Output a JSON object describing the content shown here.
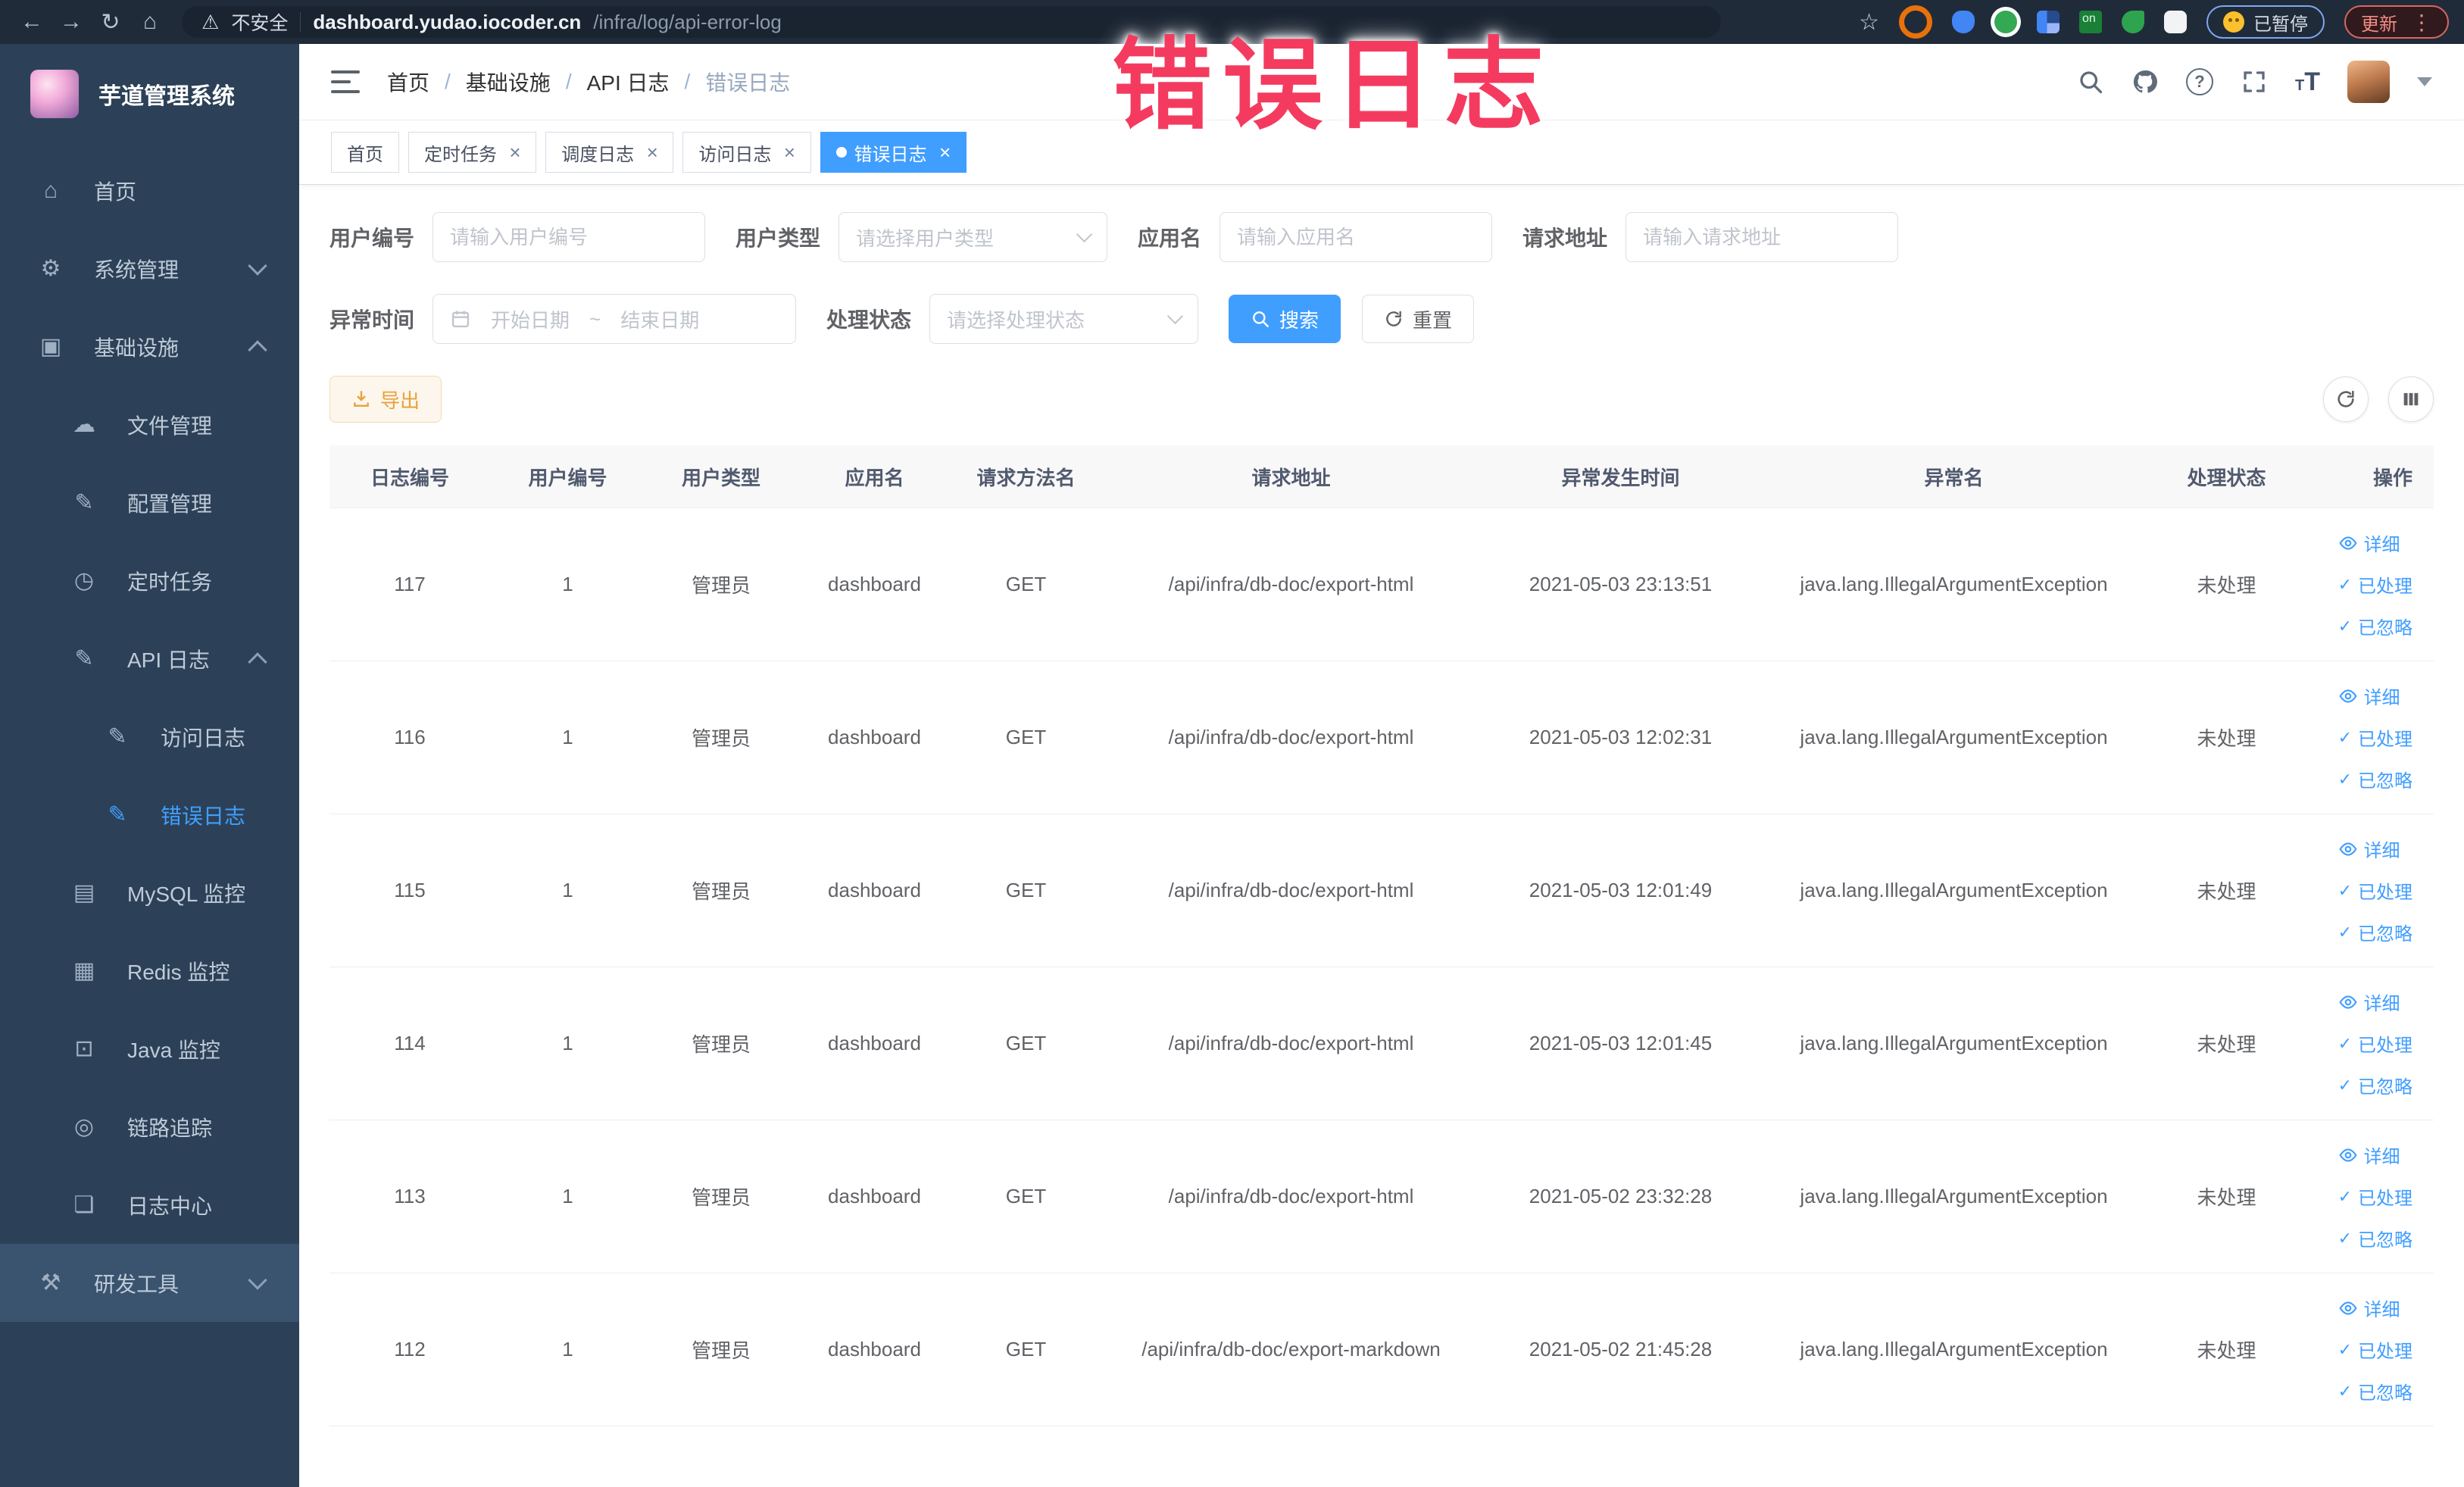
{
  "browser": {
    "security_label": "不安全",
    "url_host": "dashboard.yudao.iocoder.cn",
    "url_path": "/infra/log/api-error-log",
    "paused_badge": "已暂停",
    "update_label": "更新"
  },
  "overlay_title": "错误日志",
  "colors": {
    "primary": "#409eff",
    "overlay_red": "#f43b5f",
    "export_orange": "#e6a23c",
    "sidebar_bg": "#2c4157",
    "chrome_bg": "#202b3a"
  },
  "sidebar": {
    "logo_title": "芋道管理系统",
    "items": [
      {
        "label": "首页",
        "glyph": "⌂",
        "level": "1",
        "icon": "home-icon"
      },
      {
        "label": "系统管理",
        "glyph": "⚙",
        "level": "1",
        "arrow": "down",
        "icon": "gear-icon"
      },
      {
        "label": "基础设施",
        "glyph": "▣",
        "level": "1",
        "arrow": "up",
        "icon": "infrastructure-icon"
      },
      {
        "label": "文件管理",
        "glyph": "☁",
        "level": "2",
        "icon": "file-manage-icon"
      },
      {
        "label": "配置管理",
        "glyph": "✎",
        "level": "2",
        "icon": "config-manage-icon"
      },
      {
        "label": "定时任务",
        "glyph": "◷",
        "level": "2",
        "icon": "scheduled-job-icon"
      },
      {
        "label": "API 日志",
        "glyph": "✎",
        "level": "2",
        "arrow": "up",
        "icon": "api-log-icon"
      },
      {
        "label": "访问日志",
        "glyph": "✎",
        "level": "3",
        "icon": "access-log-icon"
      },
      {
        "label": "错误日志",
        "glyph": "✎",
        "level": "3",
        "active": true,
        "icon": "error-log-icon"
      },
      {
        "label": "MySQL 监控",
        "glyph": "▤",
        "level": "2",
        "icon": "mysql-monitor-icon"
      },
      {
        "label": "Redis 监控",
        "glyph": "▦",
        "level": "2",
        "icon": "redis-monitor-icon"
      },
      {
        "label": "Java 监控",
        "glyph": "⊡",
        "level": "2",
        "icon": "java-monitor-icon"
      },
      {
        "label": "链路追踪",
        "glyph": "◎",
        "level": "2",
        "icon": "trace-icon"
      },
      {
        "label": "日志中心",
        "glyph": "❏",
        "level": "2",
        "icon": "log-center-icon"
      },
      {
        "label": "研发工具",
        "glyph": "⚒",
        "level": "1",
        "arrow": "down",
        "highlight": true,
        "icon": "devtools-icon"
      }
    ]
  },
  "breadcrumb": {
    "items": [
      "首页",
      "基础设施",
      "API 日志"
    ],
    "separator": "/",
    "current": "错误日志"
  },
  "tabs": [
    {
      "label": "首页"
    },
    {
      "label": "定时任务",
      "closable": true
    },
    {
      "label": "调度日志",
      "closable": true
    },
    {
      "label": "访问日志",
      "closable": true
    },
    {
      "label": "错误日志",
      "closable": true,
      "active": true
    }
  ],
  "filters": {
    "user_no": {
      "label": "用户编号",
      "placeholder": "请输入用户编号"
    },
    "user_type": {
      "label": "用户类型",
      "placeholder": "请选择用户类型"
    },
    "app_name": {
      "label": "应用名",
      "placeholder": "请输入应用名"
    },
    "req_url": {
      "label": "请求地址",
      "placeholder": "请输入请求地址"
    },
    "time": {
      "label": "异常时间",
      "start": "开始日期",
      "sep": "~",
      "end": "结束日期"
    },
    "status": {
      "label": "处理状态",
      "placeholder": "请选择处理状态"
    },
    "search_label": "搜索",
    "reset_label": "重置"
  },
  "toolbar": {
    "export_label": "导出"
  },
  "table": {
    "columns": [
      "日志编号",
      "用户编号",
      "用户类型",
      "应用名",
      "请求方法名",
      "请求地址",
      "异常发生时间",
      "异常名",
      "处理状态",
      "操作"
    ],
    "actions": [
      "详细",
      "已处理",
      "已忽略"
    ],
    "rows": [
      {
        "id": "117",
        "user_id": "1",
        "user_type": "管理员",
        "app": "dashboard",
        "method": "GET",
        "url": "/api/infra/db-doc/export-html",
        "time": "2021-05-03 23:13:51",
        "exception": "java.lang.IllegalArgumentException",
        "status": "未处理"
      },
      {
        "id": "116",
        "user_id": "1",
        "user_type": "管理员",
        "app": "dashboard",
        "method": "GET",
        "url": "/api/infra/db-doc/export-html",
        "time": "2021-05-03 12:02:31",
        "exception": "java.lang.IllegalArgumentException",
        "status": "未处理"
      },
      {
        "id": "115",
        "user_id": "1",
        "user_type": "管理员",
        "app": "dashboard",
        "method": "GET",
        "url": "/api/infra/db-doc/export-html",
        "time": "2021-05-03 12:01:49",
        "exception": "java.lang.IllegalArgumentException",
        "status": "未处理"
      },
      {
        "id": "114",
        "user_id": "1",
        "user_type": "管理员",
        "app": "dashboard",
        "method": "GET",
        "url": "/api/infra/db-doc/export-html",
        "time": "2021-05-03 12:01:45",
        "exception": "java.lang.IllegalArgumentException",
        "status": "未处理"
      },
      {
        "id": "113",
        "user_id": "1",
        "user_type": "管理员",
        "app": "dashboard",
        "method": "GET",
        "url": "/api/infra/db-doc/export-html",
        "time": "2021-05-02 23:32:28",
        "exception": "java.lang.IllegalArgumentException",
        "status": "未处理"
      },
      {
        "id": "112",
        "user_id": "1",
        "user_type": "管理员",
        "app": "dashboard",
        "method": "GET",
        "url": "/api/infra/db-doc/export-markdown",
        "time": "2021-05-02 21:45:28",
        "exception": "java.lang.IllegalArgumentException",
        "status": "未处理"
      }
    ]
  }
}
